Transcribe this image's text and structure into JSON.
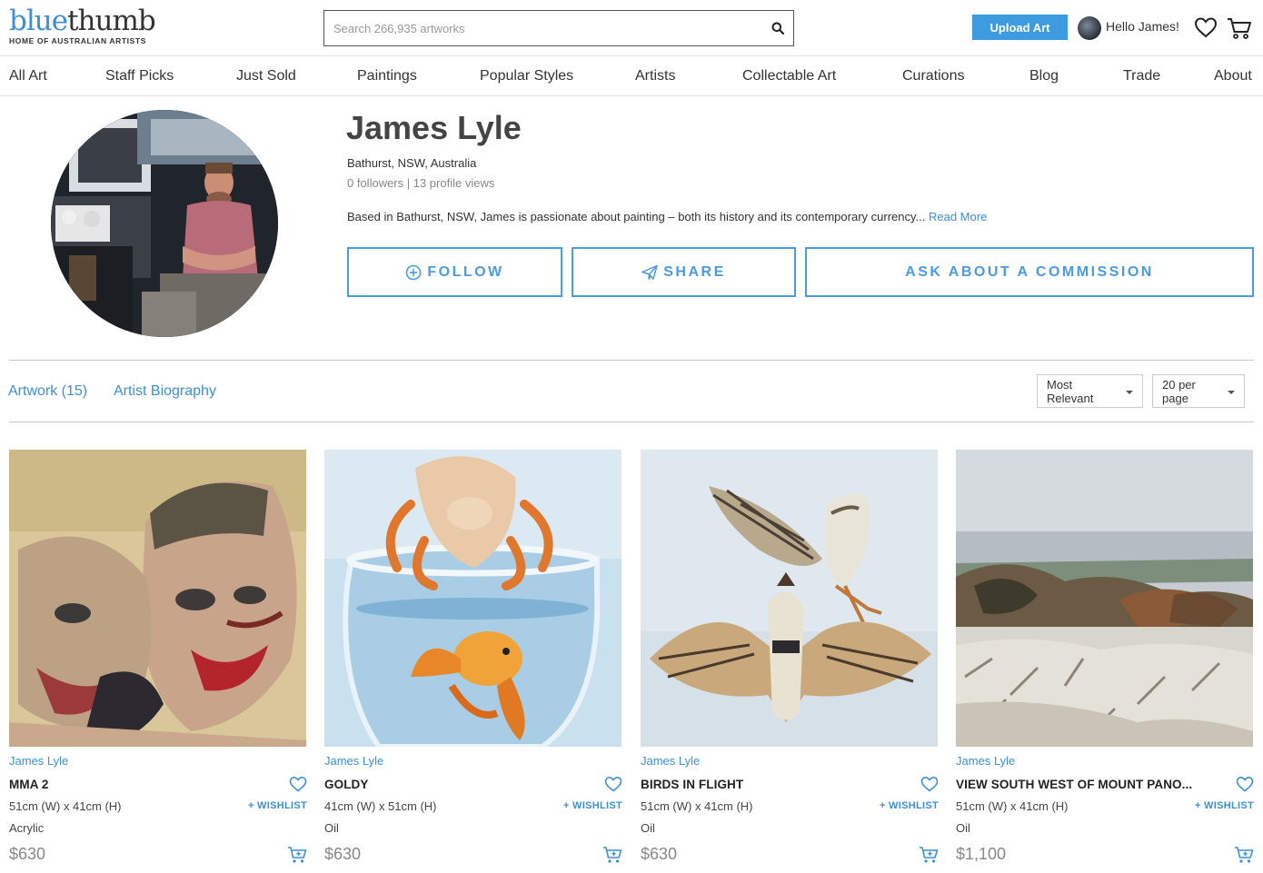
{
  "header": {
    "logo_blue": "blue",
    "logo_dark": "thumb",
    "logo_tagline": "HOME OF AUSTRALIAN ARTISTS",
    "search_placeholder": "Search 266,935 artworks",
    "upload_label": "Upload Art",
    "greeting": "Hello James!"
  },
  "nav": {
    "items": [
      "All Art",
      "Staff Picks",
      "Just Sold",
      "Paintings",
      "Popular Styles",
      "Artists",
      "Collectable Art",
      "Curations",
      "Blog",
      "Trade",
      "About"
    ]
  },
  "artist": {
    "name": "James Lyle",
    "location": "Bathurst, NSW, Australia",
    "stats": "0 followers | 13 profile views",
    "bio": "Based in Bathurst, NSW, James is passionate about painting – both its history and its contemporary currency...",
    "read_more": "Read More"
  },
  "actions": {
    "follow": "FOLLOW",
    "share": "SHARE",
    "commission": "ASK ABOUT A COMMISSION"
  },
  "tabs": {
    "artwork": "Artwork (15)",
    "biography": "Artist Biography",
    "sort": "Most Relevant",
    "per_page": "20 per page"
  },
  "cards": [
    {
      "artist": "James Lyle",
      "title": "MMA 2",
      "size": "51cm (W) x 41cm (H)",
      "medium": "Acrylic",
      "price": "$630",
      "wishlist": "+ WISHLIST"
    },
    {
      "artist": "James Lyle",
      "title": "GOLDY",
      "size": "41cm (W) x 51cm (H)",
      "medium": "Oil",
      "price": "$630",
      "wishlist": "+ WISHLIST"
    },
    {
      "artist": "James Lyle",
      "title": "BIRDS IN FLIGHT",
      "size": "51cm (W) x 41cm (H)",
      "medium": "Oil",
      "price": "$630",
      "wishlist": "+ WISHLIST"
    },
    {
      "artist": "James Lyle",
      "title": "VIEW SOUTH WEST OF MOUNT PANO...",
      "size": "51cm (W) x 41cm (H)",
      "medium": "Oil",
      "price": "$1,100",
      "wishlist": "+ WISHLIST"
    }
  ],
  "colors": {
    "accent": "#3d8fd6",
    "button": "#3d9be0"
  }
}
